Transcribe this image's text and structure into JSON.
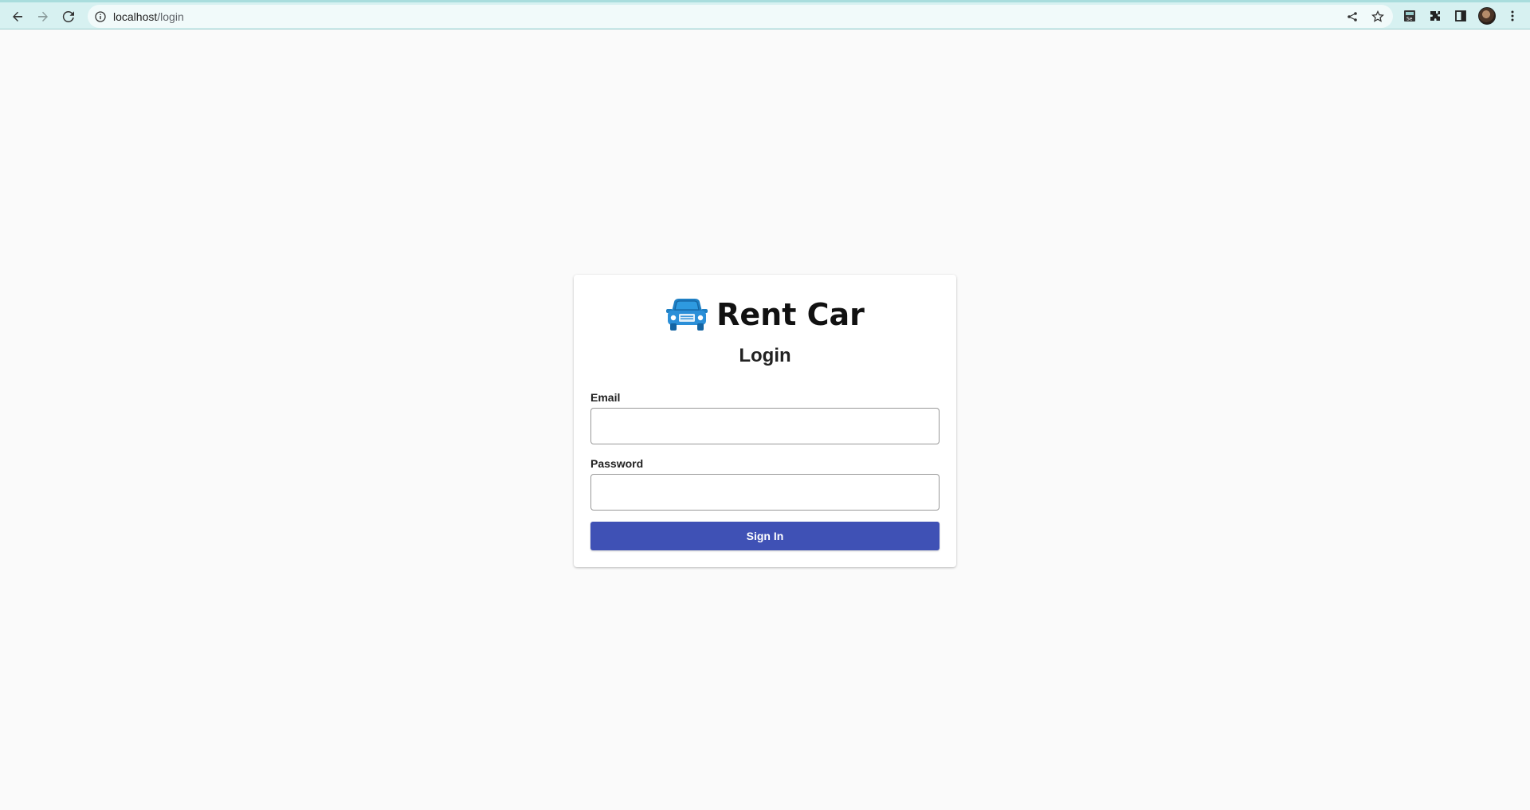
{
  "browser": {
    "url_host": "localhost",
    "url_path": "/login",
    "icons": [
      "back-icon",
      "forward-icon",
      "reload-icon",
      "site-info-icon",
      "share-icon",
      "bookmark-star-icon",
      "extension-se-icon",
      "extensions-puzzle-icon",
      "side-panel-icon",
      "profile-avatar",
      "menu-kebab-icon"
    ]
  },
  "brand": {
    "name": "Rent Car",
    "icon": "car-icon",
    "icon_color": "#1e7fc4"
  },
  "form": {
    "title": "Login",
    "email_label": "Email",
    "email_value": "",
    "password_label": "Password",
    "password_value": "",
    "submit_label": "Sign In"
  },
  "colors": {
    "primary": "#3f51b5",
    "background": "#fafafa",
    "chrome": "#d7f1f1"
  }
}
